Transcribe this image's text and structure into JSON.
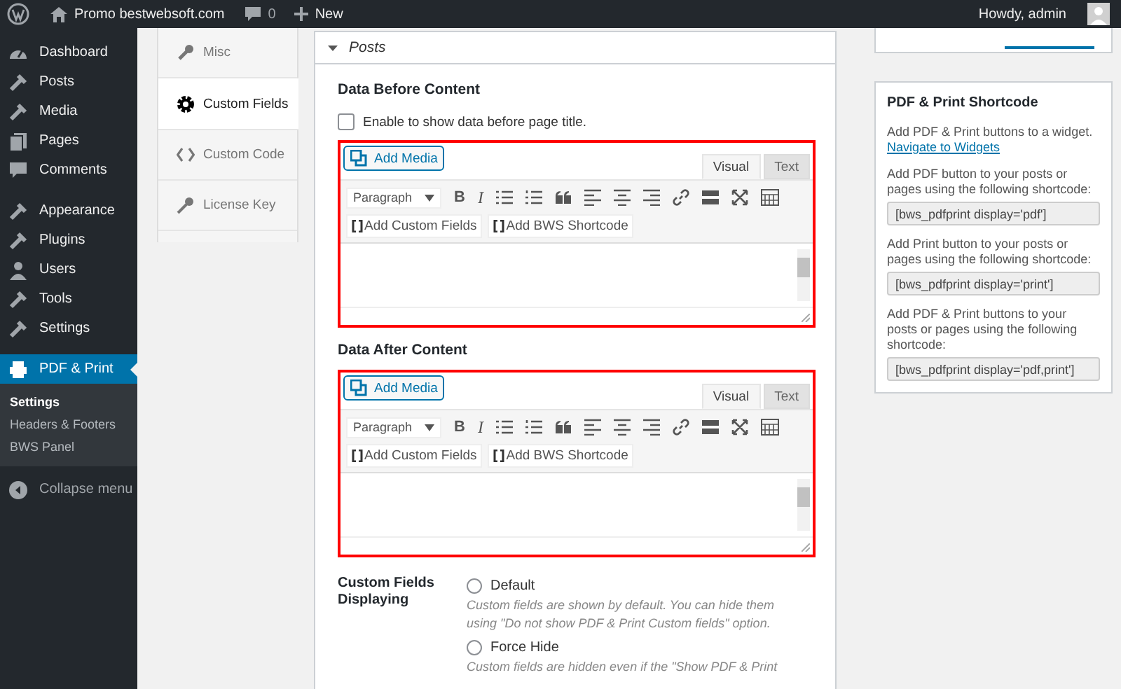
{
  "admin_bar": {
    "site": "Promo bestwebsoft.com",
    "comments": "0",
    "new": "New",
    "greeting": "Howdy, admin"
  },
  "sidebar": {
    "groups": [
      [
        {
          "label": "Dashboard",
          "selected": false
        },
        {
          "label": "Posts",
          "selected": false
        },
        {
          "label": "Media",
          "selected": false
        },
        {
          "label": "Pages",
          "selected": false
        },
        {
          "label": "Comments",
          "selected": false
        }
      ],
      [
        {
          "label": "Appearance",
          "selected": false
        },
        {
          "label": "Plugins",
          "selected": false
        },
        {
          "label": "Users",
          "selected": false
        },
        {
          "label": "Tools",
          "selected": false
        },
        {
          "label": "Settings",
          "selected": false
        }
      ],
      [
        {
          "label": "PDF & Print",
          "selected": true,
          "children": [
            {
              "label": "Settings",
              "selected": true
            },
            {
              "label": "Headers & Footers",
              "selected": false
            },
            {
              "label": "BWS Panel",
              "selected": false
            }
          ]
        }
      ]
    ],
    "collapse": "Collapse menu"
  },
  "tabs": [
    {
      "label": "Misc",
      "selected": false
    },
    {
      "label": "Custom Fields",
      "selected": true
    },
    {
      "label": "Custom Code",
      "selected": false
    },
    {
      "label": "License Key",
      "selected": false
    }
  ],
  "section": {
    "title": "Posts",
    "expanded": true
  },
  "before": {
    "heading": "Data Before Content",
    "checkbox": {
      "label": "Enable to show data before page title.",
      "checked": false
    }
  },
  "editors": [
    {
      "add_media": "Add Media",
      "modes": [
        {
          "label": "Visual",
          "selected": true
        },
        {
          "label": "Text",
          "selected": false
        }
      ],
      "format": "Paragraph",
      "bold": "B",
      "italic": "I",
      "buttons": [
        "Add Custom Fields",
        "Add BWS Shortcode"
      ]
    },
    {
      "add_media": "Add Media",
      "modes": [
        {
          "label": "Visual",
          "selected": true
        },
        {
          "label": "Text",
          "selected": false
        }
      ],
      "format": "Paragraph",
      "bold": "B",
      "italic": "I",
      "buttons": [
        "Add Custom Fields",
        "Add BWS Shortcode"
      ]
    }
  ],
  "after": {
    "heading": "Data After Content"
  },
  "displaying": {
    "label": "Custom Fields Displaying",
    "options": [
      {
        "label": "Default",
        "selected": false,
        "description": "Custom fields are shown by default. You can hide them using \"Do not show PDF & Print Custom fields\" option."
      },
      {
        "label": "Force Hide",
        "selected": false,
        "description": "Custom fields are hidden even if the \"Show PDF & Print"
      }
    ]
  },
  "shortcode_box": {
    "title": "PDF & Print Shortcode",
    "intro": "Add PDF & Print buttons to a widget.",
    "link": "Navigate to Widgets",
    "items": [
      {
        "text": "Add PDF button to your posts or pages using the following shortcode:",
        "code": "[bws_pdfprint display='pdf']"
      },
      {
        "text": "Add Print button to your posts or pages using the following shortcode:",
        "code": "[bws_pdfprint display='print']"
      },
      {
        "text": "Add PDF & Print buttons to your posts or pages using the following shortcode:",
        "code": "[bws_pdfprint display='pdf,print']"
      }
    ]
  }
}
